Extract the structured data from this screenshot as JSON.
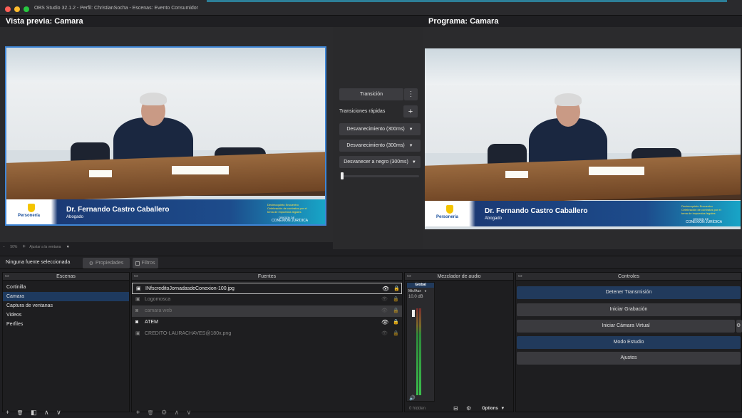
{
  "window": {
    "title": "OBS Studio 32.1.2 - Perfil: ChristianSocha - Escenas: Evento Consumidor",
    "traffic_colors": [
      "#fe5f57",
      "#febc2e",
      "#28c840"
    ]
  },
  "preview": {
    "label": "Vista previa: Camara",
    "toolbar": {
      "zoom": "50%",
      "zoom_options": "Ajustar a la ventana"
    }
  },
  "program": {
    "label": "Programa: Camara"
  },
  "lower_third": {
    "name": "Dr. Fernando Castro Caballero",
    "role": "Abogado",
    "org": "Personería",
    "org_sub": "de Bogotá D.C.",
    "event_title": "Decimoquinto Encuentro",
    "event_sub1": "Celebración de contratos por el",
    "event_sub2": "tema de impuestos legales",
    "brand_top": "ORIGEN DE",
    "brand": "CONEXIÓN JURÍDICA"
  },
  "transitions": {
    "transition_label": "Transición",
    "quick_label": "Transiciones rápidas",
    "items": [
      "Desvanecimiento (300ms)",
      "Desvanecimiento (300ms)",
      "Desvanecer a negro (300ms)"
    ],
    "tbar_level": 0
  },
  "source_bar": {
    "no_source": "Ninguna fuente seleccionada",
    "properties": "Propiedades",
    "filters": "Filtros"
  },
  "scenes": {
    "header": "Escenas",
    "items": [
      "Cortinilla",
      "Camara",
      "Captura de ventanas",
      "Videos",
      "Perfiles"
    ],
    "selected_index": 1
  },
  "sources": {
    "header": "Fuentes",
    "items": [
      {
        "name": "INfscreditoJornadasdeConexion-100.jpg",
        "visible": true,
        "type": "image"
      },
      {
        "name": "Logomosca",
        "visible": false,
        "type": "image"
      },
      {
        "name": "camara web",
        "visible": false,
        "type": "camera"
      },
      {
        "name": "ATEM",
        "visible": true,
        "type": "camera"
      },
      {
        "name": "CREDITO-LAURACHAVES@180x.png",
        "visible": false,
        "type": "image"
      }
    ]
  },
  "mixer": {
    "header": "Mezclador de audio",
    "channel_top": "Global",
    "channel_name": "Mic/Aux",
    "db": "10.0 dB",
    "footer_hidden": "0 hidden",
    "options": "Options"
  },
  "controls": {
    "header": "Controles",
    "stop_streaming": "Detener Transmisión",
    "start_recording": "Iniciar Grabación",
    "start_virtual_cam": "Iniciar Cámara Virtual",
    "studio_mode": "Modo Estudio",
    "settings": "Ajustes",
    "accent": "#213a5c"
  },
  "icons": {
    "add": "+",
    "eye": "👁",
    "lock": "🔒",
    "gear": "⚙",
    "kebab": "⋮",
    "caret": "▼",
    "up": "∧",
    "down": "∨",
    "trash": "🗑"
  }
}
